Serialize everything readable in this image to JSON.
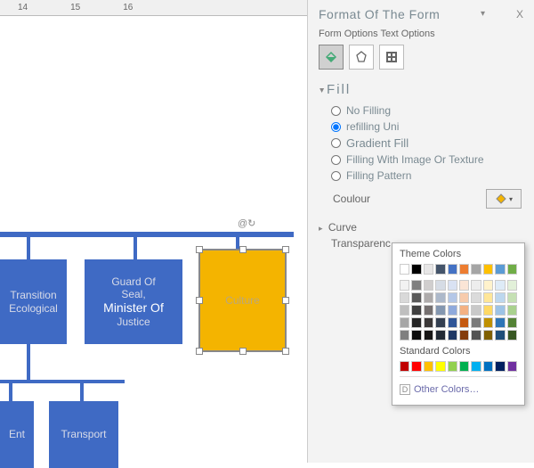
{
  "ruler": {
    "marks": [
      "14",
      "15",
      "16"
    ]
  },
  "shapes": {
    "transition": {
      "line1": "Transition",
      "line2": "Ecological"
    },
    "guard": {
      "line1": "Guard Of",
      "line2": "Seal,",
      "line3": "Minister Of",
      "line4": "Justice"
    },
    "culture": {
      "label": "Culture"
    },
    "ent": {
      "label": "Ent"
    },
    "transport": {
      "label": "Transport"
    }
  },
  "pane": {
    "title": "Format Of The Form",
    "close": "X",
    "tab1": "Form Options",
    "tab2": "Text Options",
    "fill_heading": "Fill",
    "opt_none": "No Filling",
    "opt_solid": "refilling Uni",
    "opt_gradient": "Gradient Fill",
    "opt_image": "Filling With Image Or Texture",
    "opt_pattern": "Filling Pattern",
    "color_label": "Coulour",
    "transparency_label": "Transparenc",
    "curve_label": "Curve"
  },
  "picker": {
    "theme_title": "Theme Colors",
    "standard_title": "Standard Colors",
    "other": "Other Colors…",
    "theme_row1": [
      "#ffffff",
      "#000000",
      "#e7e6e6",
      "#44546a",
      "#4472c4",
      "#ed7d31",
      "#a5a5a5",
      "#ffc000",
      "#5b9bd5",
      "#70ad47"
    ],
    "tints": [
      [
        "#f2f2f2",
        "#7f7f7f",
        "#d0cece",
        "#d6dce5",
        "#d9e2f3",
        "#fbe5d6",
        "#ededed",
        "#fff2cc",
        "#deebf7",
        "#e2f0d9"
      ],
      [
        "#d9d9d9",
        "#595959",
        "#aeabab",
        "#adb9ca",
        "#b4c7e7",
        "#f7cbac",
        "#dbdbdb",
        "#ffe699",
        "#bdd7ee",
        "#c5e0b4"
      ],
      [
        "#bfbfbf",
        "#404040",
        "#757070",
        "#8497b0",
        "#8faadc",
        "#f4b183",
        "#c9c9c9",
        "#ffd966",
        "#9dc3e6",
        "#a9d18e"
      ],
      [
        "#a6a6a6",
        "#262626",
        "#3b3838",
        "#333f50",
        "#2f5597",
        "#c55a11",
        "#7b7b7b",
        "#bf9000",
        "#2e75b6",
        "#548235"
      ],
      [
        "#7f7f7f",
        "#0d0d0d",
        "#171616",
        "#222a35",
        "#1f3864",
        "#843c0c",
        "#525252",
        "#806000",
        "#1f4e79",
        "#385723"
      ]
    ],
    "standard": [
      "#c00000",
      "#ff0000",
      "#ffc000",
      "#ffff00",
      "#92d050",
      "#00b050",
      "#00b0f0",
      "#0070c0",
      "#002060",
      "#7030a0"
    ]
  }
}
